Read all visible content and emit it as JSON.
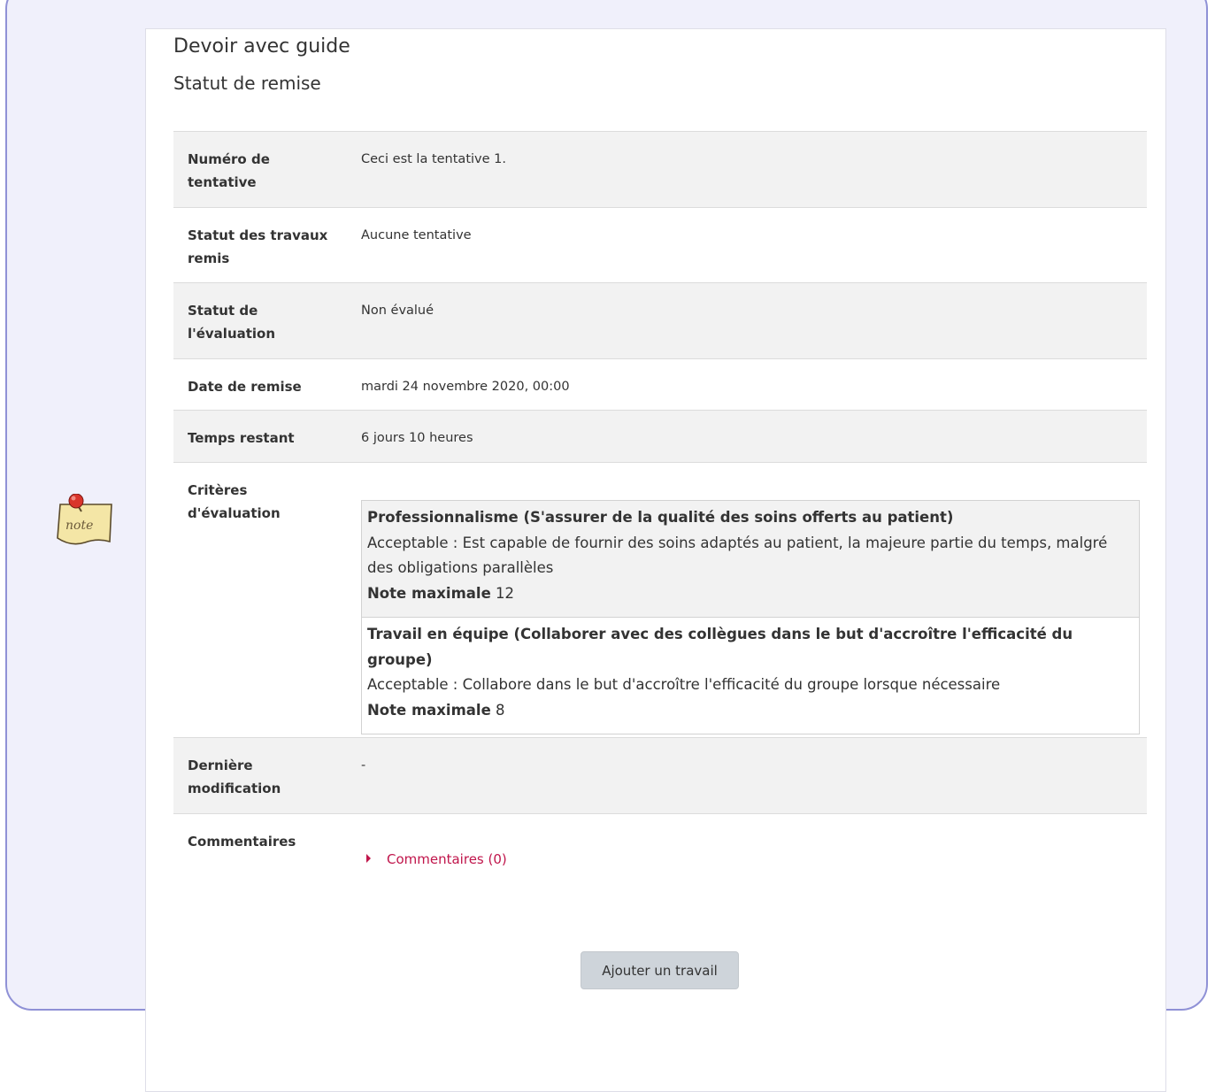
{
  "header": {
    "title": "Devoir avec guide",
    "subtitle": "Statut de remise"
  },
  "note_icon": {
    "icon": "note-icon",
    "text": "note"
  },
  "rows": {
    "attempt": {
      "label": "Numéro de tentative",
      "value": "Ceci est la tentative 1."
    },
    "submission_status": {
      "label": "Statut des travaux remis",
      "value": "Aucune tentative"
    },
    "grading_status": {
      "label": "Statut de l'évaluation",
      "value": "Non évalué"
    },
    "due_date": {
      "label": "Date de remise",
      "value": "mardi 24 novembre 2020, 00:00"
    },
    "time_remaining": {
      "label": "Temps restant",
      "value": "6 jours 10 heures"
    },
    "criteria": {
      "label": "Critères d'évaluation"
    },
    "last_modified": {
      "label": "Dernière modification",
      "value": "-"
    },
    "comments": {
      "label": "Commentaires",
      "link_text": "Commentaires (0)"
    }
  },
  "rubric": [
    {
      "title": "Professionnalisme (S'assurer de la qualité des soins offerts au patient)",
      "level": "Acceptable : Est capable de fournir des soins adaptés au patient, la majeure partie du temps, malgré des obligations parallèles",
      "max_label": "Note maximale",
      "max_value": "12"
    },
    {
      "title": "Travail en équipe (Collaborer avec des collègues dans le but d'accroître l'efficacité du groupe)",
      "level": "Acceptable : Collabore dans le but d'accroître l'efficacité du groupe lorsque nécessaire",
      "max_label": "Note maximale",
      "max_value": "8"
    }
  ],
  "actions": {
    "add_submission": "Ajouter un travail"
  },
  "colors": {
    "frame_border": "#8f91d6",
    "frame_bg": "#f0f0fb",
    "link": "#c0154b",
    "button_bg": "#ced4da"
  }
}
